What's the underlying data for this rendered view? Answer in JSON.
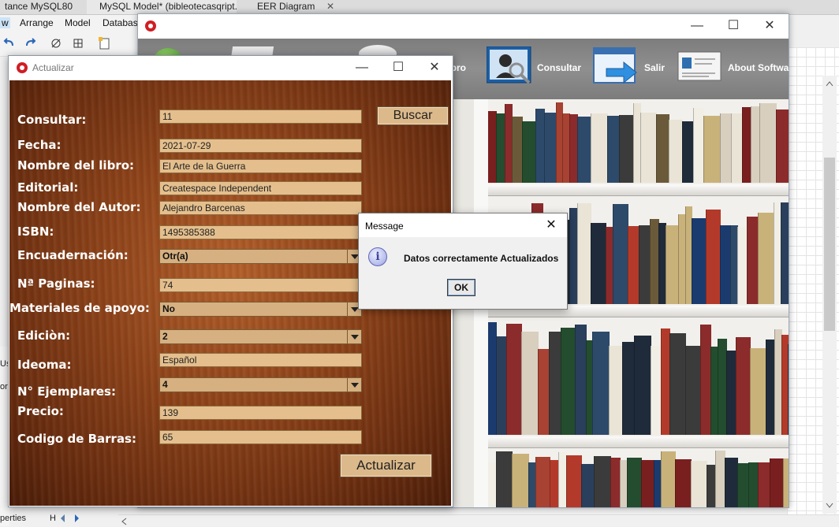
{
  "workbench": {
    "tabs": [
      {
        "label": "tance MySQL80"
      },
      {
        "label": "MySQL Model* (bibleotecasqript.m..."
      },
      {
        "label": "EER Diagram"
      }
    ],
    "tab_close_glyph": "✕",
    "menu": [
      "w",
      "Arrange",
      "Model",
      "Database"
    ],
    "side_labels": {
      "us": "Us",
      "or": "or",
      "properties": "perties",
      "h": "H"
    }
  },
  "main_window": {
    "toolbar": {
      "items": [
        {
          "label": "libro",
          "icon": "book-icon"
        },
        {
          "label": "Consultar",
          "icon": "search-person-icon"
        },
        {
          "label": "Salir",
          "icon": "exit-icon"
        },
        {
          "label": "About Softwa",
          "icon": "id-card-icon"
        }
      ]
    },
    "controls": {
      "minimize": "—",
      "maximize": "☐",
      "close": "✕"
    }
  },
  "actualizar_dialog": {
    "title": "Actualizar",
    "controls": {
      "minimize": "—",
      "maximize": "☐",
      "close": "✕"
    },
    "search_button": "Buscar",
    "submit_button": "Actualizar",
    "fields": {
      "consultar": {
        "label": "Consultar:",
        "value": "11"
      },
      "fecha": {
        "label": "Fecha:",
        "value": "2021-07-29"
      },
      "nombre_libro": {
        "label": "Nombre del libro:",
        "value": "El Arte de la Guerra"
      },
      "editorial": {
        "label": "Editorial:",
        "value": "Createspace Independent"
      },
      "nombre_autor": {
        "label": "Nombre del Autor:",
        "value": "Alejandro Barcenas"
      },
      "isbn": {
        "label": "ISBN:",
        "value": "1495385388"
      },
      "encuadernacion": {
        "label": "Encuadernación:",
        "value": "Otr(a)"
      },
      "paginas": {
        "label": "Nª Paginas:",
        "value": "74"
      },
      "materiales": {
        "label": "Materiales de apoyo:",
        "value": "No"
      },
      "edicion": {
        "label": "Ediciòn:",
        "value": "2"
      },
      "idioma": {
        "label": "Ideoma:",
        "value": "Español"
      },
      "ejemplares": {
        "label": "N° Ejemplares:",
        "value": "4"
      },
      "precio": {
        "label": "Precio:",
        "value": "139"
      },
      "codigo_barras": {
        "label": "Codigo de Barras:",
        "value": "65"
      }
    }
  },
  "message_dialog": {
    "title": "Message",
    "close": "✕",
    "icon": "info-icon",
    "icon_glyph": "i",
    "text": "Datos correctamente Actualizados",
    "ok_button": "OK"
  }
}
